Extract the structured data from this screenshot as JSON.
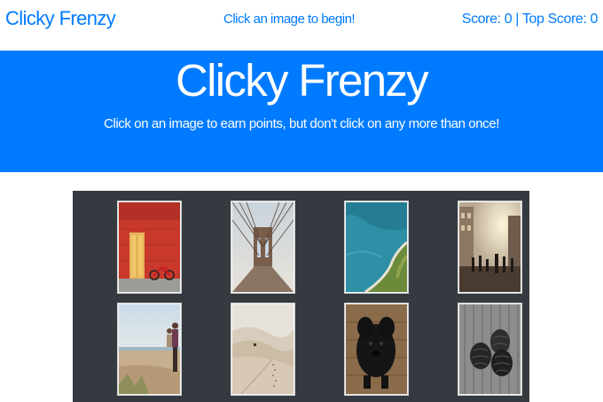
{
  "navbar": {
    "brand": "Clicky Frenzy",
    "status_message": "Click an image to begin!",
    "score_label": "Score:",
    "score_value": "0",
    "separator": "|",
    "top_score_label": "Top Score:",
    "top_score_value": "0"
  },
  "hero": {
    "title": "Clicky Frenzy",
    "subtitle": "Click on an image to earn points, but don't click on any more than once!"
  },
  "images": [
    {
      "name": "red-door-bicycle-image"
    },
    {
      "name": "bridge-cables-image"
    },
    {
      "name": "aerial-coastline-image"
    },
    {
      "name": "city-street-sunset-image"
    },
    {
      "name": "beach-couple-image"
    },
    {
      "name": "desert-dunes-image"
    },
    {
      "name": "black-dog-image"
    },
    {
      "name": "pinecones-image"
    }
  ],
  "colors": {
    "brand": "#007bff",
    "hero_text": "#ffffff",
    "board": "#343a40"
  }
}
